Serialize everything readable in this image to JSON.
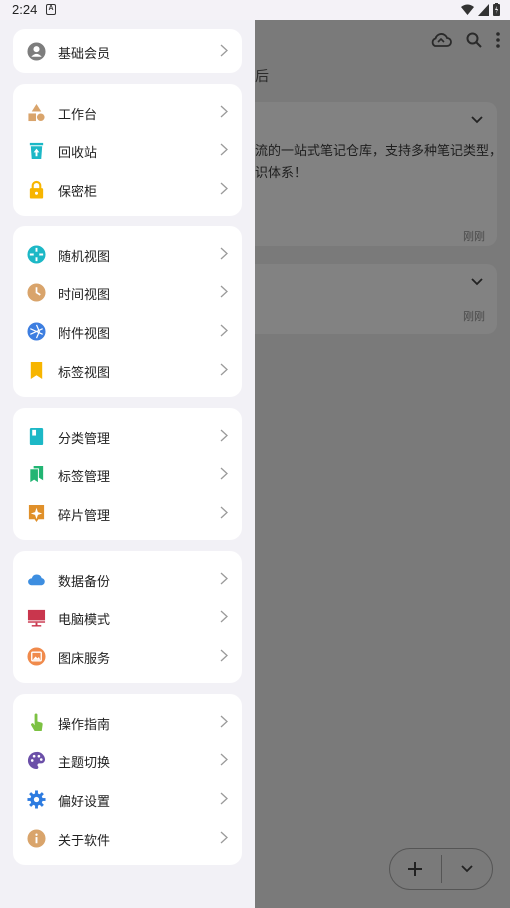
{
  "status": {
    "time": "2:24",
    "notif_letter": "A"
  },
  "main": {
    "header_text": "后",
    "card1": {
      "line1": "流的一站式笔记仓库，支持多种笔记类型，",
      "line2": "识体系！",
      "time": "刚刚"
    },
    "card2": {
      "time": "刚刚"
    },
    "fab": {
      "add_icon": "plus-icon",
      "more_icon": "chevron-down-icon"
    }
  },
  "drawer": {
    "member": {
      "label": "基础会员",
      "icon": "account-circle-icon"
    },
    "groups": [
      [
        {
          "label": "工作台",
          "icon": "shapes-icon"
        },
        {
          "label": "回收站",
          "icon": "trash-icon"
        },
        {
          "label": "保密柜",
          "icon": "lock-icon"
        }
      ],
      [
        {
          "label": "随机视图",
          "icon": "random-icon"
        },
        {
          "label": "时间视图",
          "icon": "clock-icon"
        },
        {
          "label": "附件视图",
          "icon": "aperture-icon"
        },
        {
          "label": "标签视图",
          "icon": "bookmark-icon"
        }
      ],
      [
        {
          "label": "分类管理",
          "icon": "category-icon"
        },
        {
          "label": "标签管理",
          "icon": "bookmarks-icon"
        },
        {
          "label": "碎片管理",
          "icon": "fragment-icon"
        }
      ],
      [
        {
          "label": "数据备份",
          "icon": "cloud-icon"
        },
        {
          "label": "电脑模式",
          "icon": "desktop-icon"
        },
        {
          "label": "图床服务",
          "icon": "image-icon"
        }
      ],
      [
        {
          "label": "操作指南",
          "icon": "touch-icon"
        },
        {
          "label": "主题切换",
          "icon": "palette-icon"
        },
        {
          "label": "偏好设置",
          "icon": "gear-icon"
        },
        {
          "label": "关于软件",
          "icon": "info-icon"
        }
      ]
    ]
  },
  "colors": {
    "drawer_bg": "#f2f1f6",
    "card_bg": "#ffffff",
    "scrim": "#7a7a7a"
  }
}
